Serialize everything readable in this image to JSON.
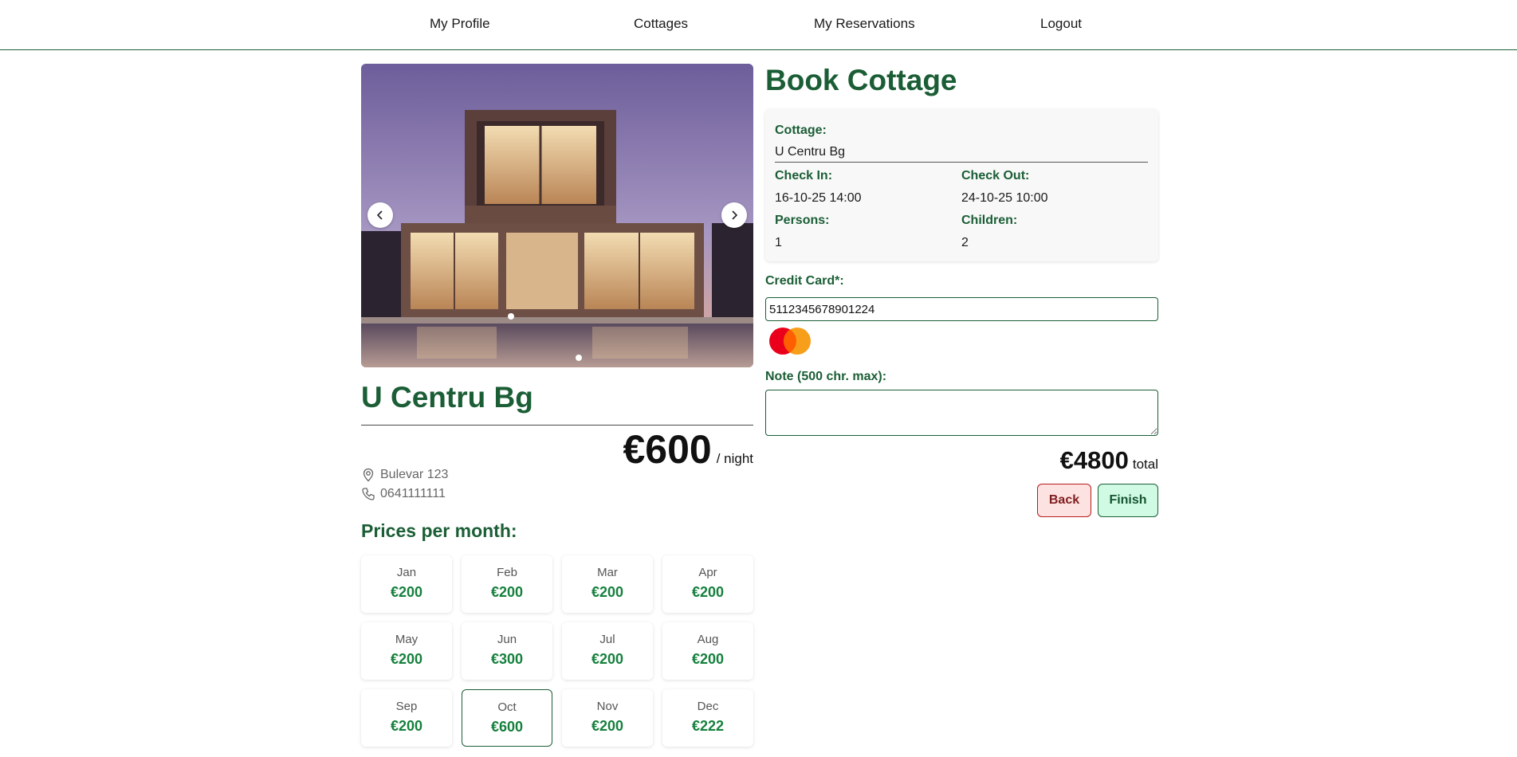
{
  "nav": {
    "items": [
      "My Profile",
      "Cottages",
      "My Reservations",
      "Logout"
    ]
  },
  "cottage": {
    "name": "U Centru Bg",
    "price": "€600",
    "price_unit": "/ night",
    "address": "Bulevar 123",
    "phone": "0641111111",
    "image_count": 2,
    "active_image": 1
  },
  "months": {
    "title": "Prices per month:",
    "items": [
      {
        "name": "Jan",
        "price": "€200"
      },
      {
        "name": "Feb",
        "price": "€200"
      },
      {
        "name": "Mar",
        "price": "€200"
      },
      {
        "name": "Apr",
        "price": "€200"
      },
      {
        "name": "May",
        "price": "€200"
      },
      {
        "name": "Jun",
        "price": "€300"
      },
      {
        "name": "Jul",
        "price": "€200"
      },
      {
        "name": "Aug",
        "price": "€200"
      },
      {
        "name": "Sep",
        "price": "€200"
      },
      {
        "name": "Oct",
        "price": "€600"
      },
      {
        "name": "Nov",
        "price": "€200"
      },
      {
        "name": "Dec",
        "price": "€222"
      }
    ],
    "active": "Oct"
  },
  "booking": {
    "title": "Book Cottage",
    "cottage_label": "Cottage:",
    "cottage_value": "U Centru Bg",
    "checkin_label": "Check In:",
    "checkin_value": "16-10-25 14:00",
    "checkout_label": "Check Out:",
    "checkout_value": "24-10-25 10:00",
    "persons_label": "Persons:",
    "persons_value": "1",
    "children_label": "Children:",
    "children_value": "2",
    "credit_card_label": "Credit Card*:",
    "credit_card_value": "5112345678901224",
    "card_brand_icon": "mastercard-icon",
    "note_label": "Note (500 chr. max):",
    "note_value": "",
    "total": "€4800",
    "total_unit": "total",
    "back_label": "Back",
    "finish_label": "Finish"
  },
  "colors": {
    "accent": "#1b5e36",
    "price_green": "#15803d",
    "back_bg": "#fde2e2",
    "finish_bg": "#d1fae5"
  }
}
